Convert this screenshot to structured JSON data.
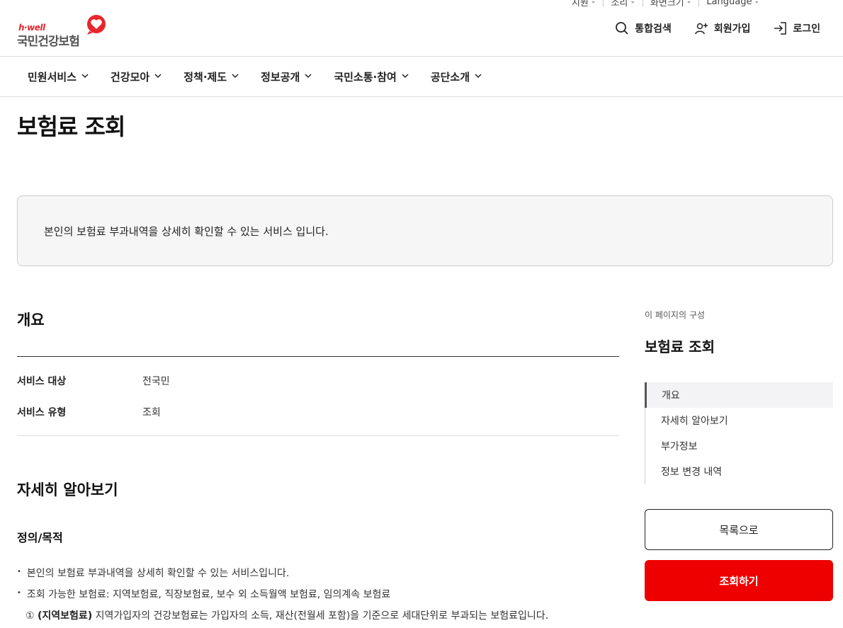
{
  "utility": {
    "items": [
      {
        "label": "지원"
      },
      {
        "label": "소리"
      },
      {
        "label": "화면크기"
      },
      {
        "label": "Language"
      }
    ]
  },
  "logo": {
    "small": "h·well",
    "main": "국민건강보험"
  },
  "header_actions": {
    "search": "통합검색",
    "signup": "회원가입",
    "login": "로그인"
  },
  "gnb": {
    "items": [
      {
        "label": "민원서비스"
      },
      {
        "label": "건강모아"
      },
      {
        "label": "정책·제도"
      },
      {
        "label": "정보공개"
      },
      {
        "label": "국민소통·참여"
      },
      {
        "label": "공단소개"
      }
    ]
  },
  "page": {
    "title": "보험료 조회",
    "intro": "본인의 보험료 부과내역을 상세히 확인할 수 있는 서비스 입니다."
  },
  "overview": {
    "heading": "개요",
    "rows": [
      {
        "key": "서비스 대상",
        "value": "전국민"
      },
      {
        "key": "서비스 유형",
        "value": "조회"
      }
    ]
  },
  "details": {
    "heading": "자세히 알아보기",
    "subheading": "정의/목적",
    "bullets": [
      "본인의 보험료 부과내역을 상세히 확인할 수 있는 서비스입니다.",
      "조회 가능한 보험료: 지역보험료, 직장보험료, 보수 외 소득월액 보험료, 임의계속 보험료"
    ],
    "numbered": {
      "marker": "①",
      "bold": "(지역보험료)",
      "text": " 지역가입자의 건강보험료는 가입자의 소득, 재산(전월세 포함)을 기준으로 세대단위로 부과되는 보험료입니다."
    }
  },
  "sidebar": {
    "caption": "이 페이지의 구성",
    "title": "보험료 조회",
    "items": [
      {
        "label": "개요"
      },
      {
        "label": "자세히 알아보기"
      },
      {
        "label": "부가정보"
      },
      {
        "label": "정보 변경 내역"
      }
    ],
    "list_button": "목록으로",
    "query_button": "조회하기"
  },
  "colors": {
    "brand_red": "#ee0000",
    "accent_red": "#e8262c"
  }
}
